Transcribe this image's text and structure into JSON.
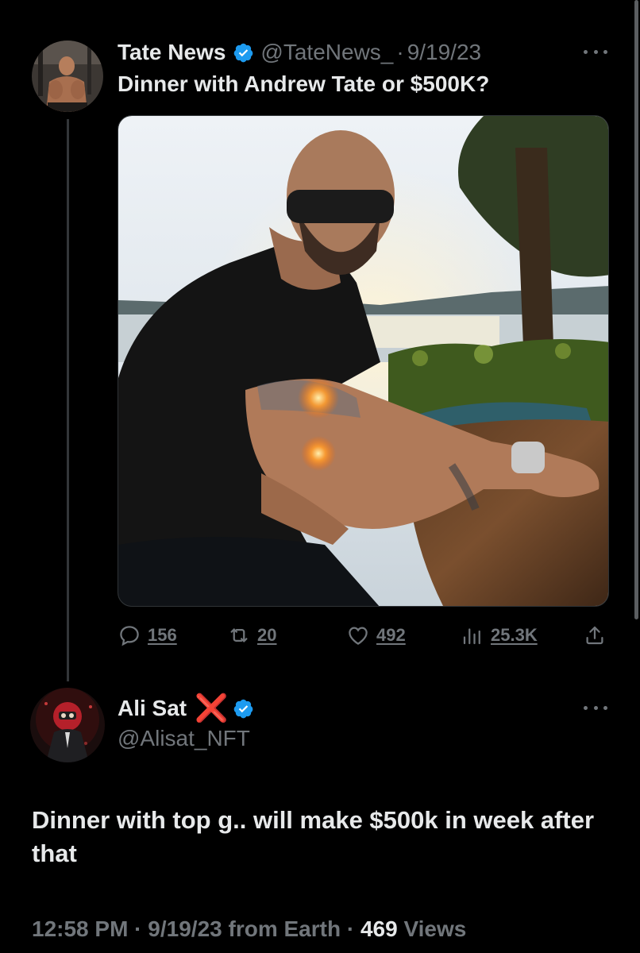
{
  "tweet1": {
    "author_name": "Tate News",
    "handle": "@TateNews_",
    "separator": "·",
    "date": "9/19/23",
    "text": "Dinner with Andrew Tate or $500K?",
    "stats": {
      "replies": "156",
      "reposts": "20",
      "likes": "492",
      "views": "25.3K"
    },
    "icons": [
      "verified-badge-icon",
      "more-icon",
      "reply-icon",
      "repost-icon",
      "like-icon",
      "views-icon",
      "share-icon"
    ]
  },
  "tweet2": {
    "author_name": "Ali Sat",
    "name_emoji": "❌",
    "handle": "@Alisat_NFT",
    "text": "Dinner with top g.. will make $500k in week after that",
    "time": "12:58 PM",
    "sep1": " · ",
    "date": "9/19/23",
    "source": " from Earth",
    "sep2": " · ",
    "views_count": "469",
    "views_label": " Views"
  },
  "colors": {
    "background": "#000000",
    "text": "#e7e9ea",
    "secondary": "#71767b",
    "verified": "#1d9bf0",
    "red_x": "#e0241b"
  }
}
